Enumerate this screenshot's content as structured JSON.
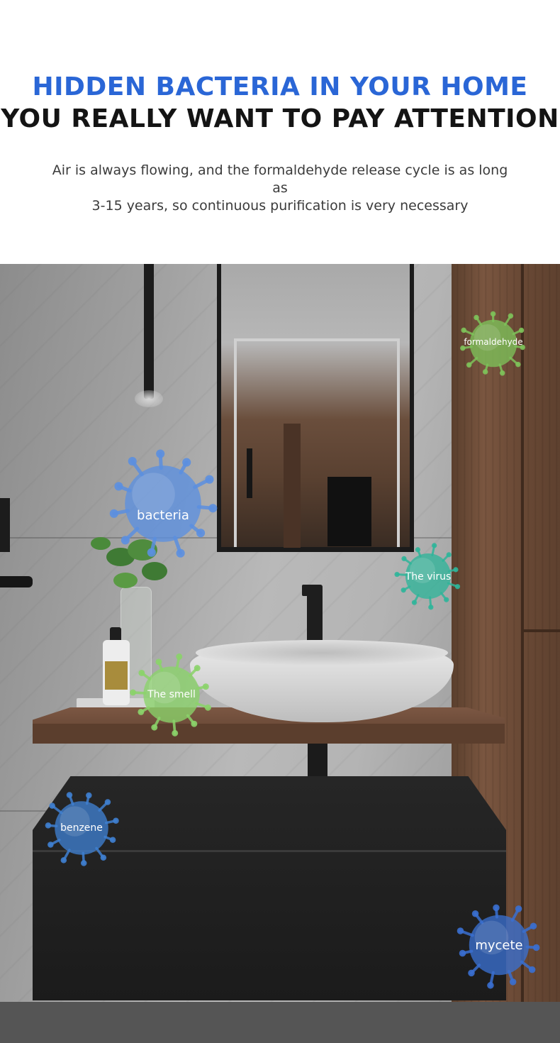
{
  "header": {
    "title_line1": "HIDDEN BACTERIA IN YOUR HOME",
    "title_line2": "YOU REALLY WANT TO PAY ATTENTION",
    "subtitle_line1": "Air is always flowing, and the formaldehyde release cycle is as long as",
    "subtitle_line2": "3-15 years, so continuous purification is very necessary"
  },
  "colors": {
    "accent_blue": "#2a66d6",
    "title_dark": "#141414"
  },
  "germs": {
    "formaldehyde": {
      "label": "formaldehyde",
      "icon": "virus-icon",
      "color": "#7ec25a"
    },
    "bacteria": {
      "label": "bacteria",
      "icon": "virus-icon",
      "color": "#5b8fe0"
    },
    "virus": {
      "label": "The virus",
      "icon": "virus-icon",
      "color": "#2fb59a"
    },
    "smell": {
      "label": "The smell",
      "icon": "virus-icon",
      "color": "#8bd36a"
    },
    "benzene": {
      "label": "benzene",
      "icon": "virus-icon",
      "color": "#3f7fd0"
    },
    "mycete": {
      "label": "mycete",
      "icon": "virus-icon",
      "color": "#3a6fd0"
    }
  }
}
